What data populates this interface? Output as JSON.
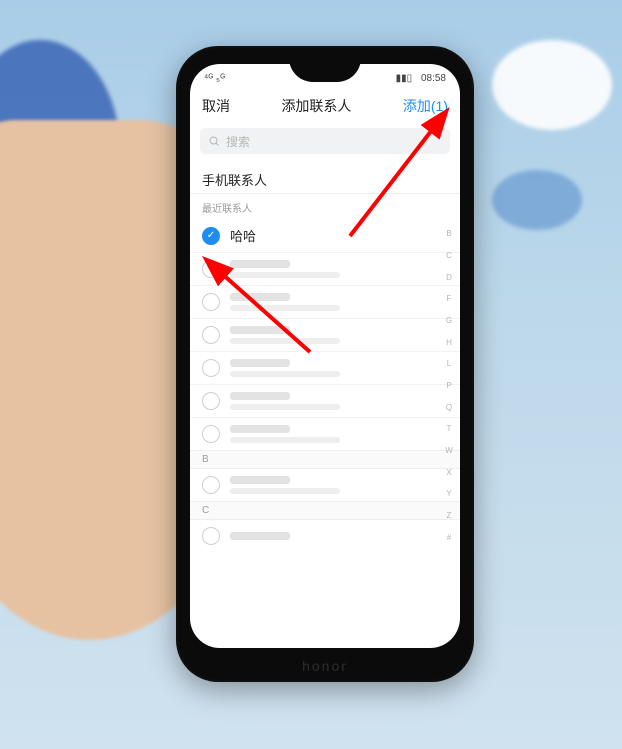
{
  "status": {
    "carrier": "⁴ᴳ ₅ᴳ",
    "signal": "📶",
    "battery": "▮▮▯",
    "time": "08:58"
  },
  "header": {
    "cancel": "取消",
    "title": "添加联系人",
    "add_prefix": "添加",
    "add_count": "(1)"
  },
  "search": {
    "placeholder": "搜索"
  },
  "sections": {
    "phone_contacts": "手机联系人",
    "recent": "最近联系人"
  },
  "contacts": [
    {
      "name": "哈哈",
      "selected": true
    }
  ],
  "group_labels": {
    "b": "B",
    "c": "C"
  },
  "index_letters": [
    "B",
    "C",
    "D",
    "F",
    "G",
    "H",
    "L",
    "P",
    "Q",
    "T",
    "W",
    "X",
    "Y",
    "Z",
    "#"
  ],
  "brand": "honor"
}
